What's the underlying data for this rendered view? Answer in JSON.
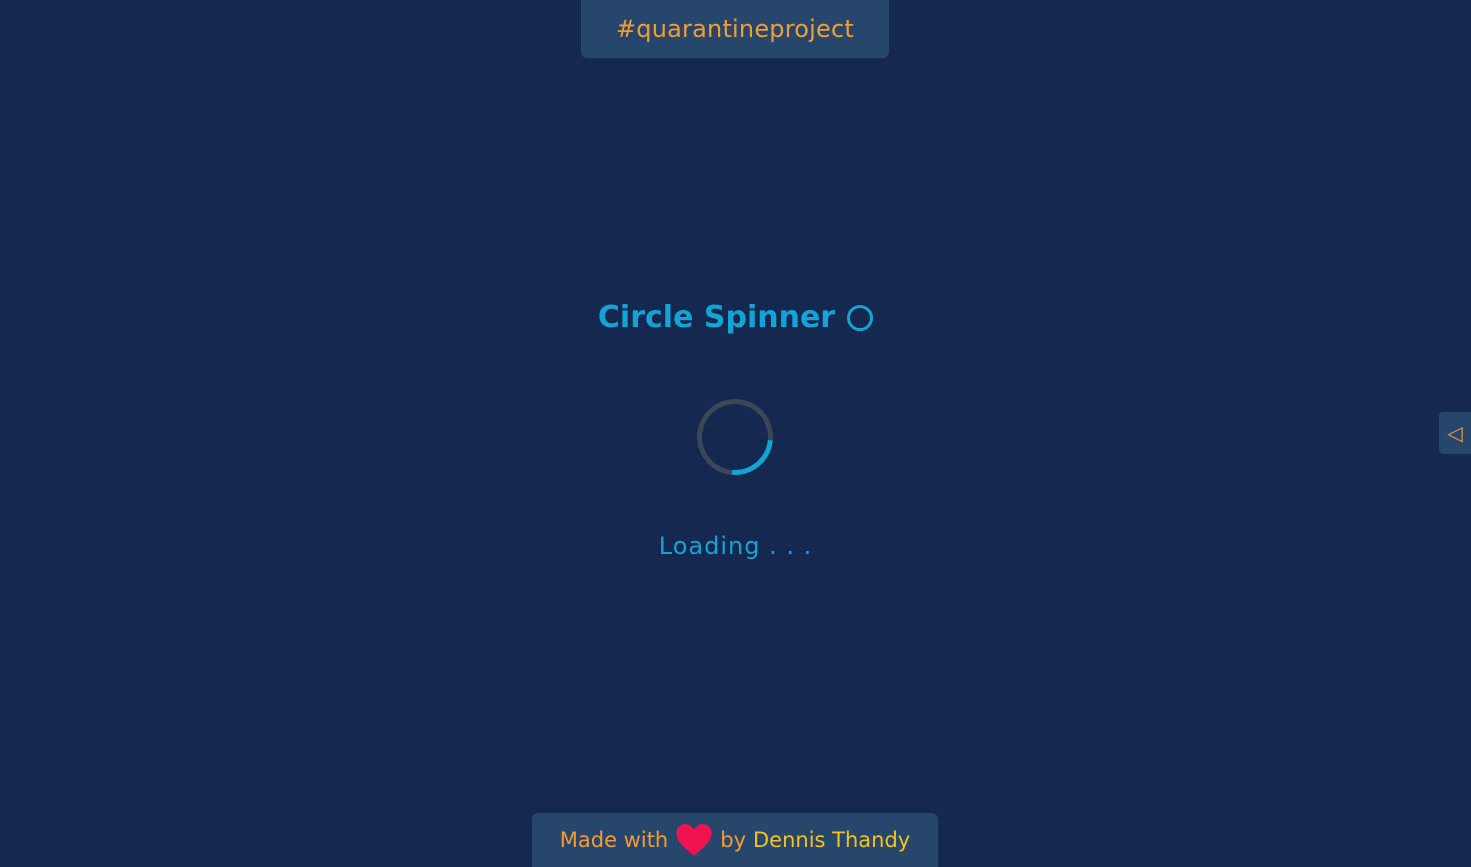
{
  "header": {
    "tag_text": "#quarantineproject"
  },
  "main": {
    "title": "Circle Spinner",
    "title_icon": "circle-outline-icon",
    "spinner_icon": "circle-spinner-icon",
    "loading_text": "Loading . . ."
  },
  "side_panel": {
    "toggle_icon": "triangle-left-icon",
    "toggle_glyph": "◁"
  },
  "footer": {
    "made_with": "Made with",
    "heart_icon": "heart-icon",
    "by": "by",
    "author": "Dennis Thandy"
  },
  "colors": {
    "background": "#152850",
    "panel": "#26466c",
    "accent_blue": "#13a3d5",
    "accent_orange": "#f39c36",
    "accent_yellow": "#f5c21b",
    "heart": "#f0134f",
    "spinner_track": "#3b4656"
  }
}
